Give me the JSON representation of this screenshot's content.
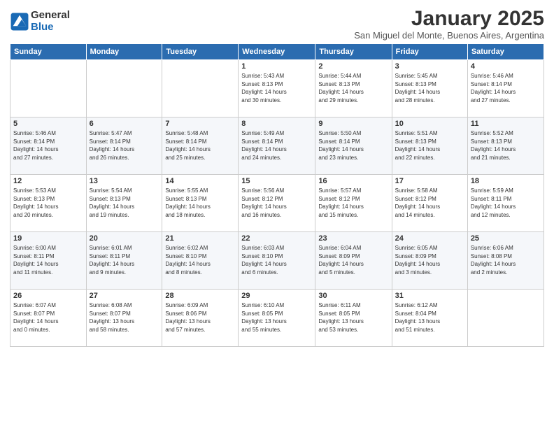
{
  "logo": {
    "general": "General",
    "blue": "Blue"
  },
  "title": "January 2025",
  "subtitle": "San Miguel del Monte, Buenos Aires, Argentina",
  "days_of_week": [
    "Sunday",
    "Monday",
    "Tuesday",
    "Wednesday",
    "Thursday",
    "Friday",
    "Saturday"
  ],
  "weeks": [
    [
      {
        "day": "",
        "info": ""
      },
      {
        "day": "",
        "info": ""
      },
      {
        "day": "",
        "info": ""
      },
      {
        "day": "1",
        "info": "Sunrise: 5:43 AM\nSunset: 8:13 PM\nDaylight: 14 hours\nand 30 minutes."
      },
      {
        "day": "2",
        "info": "Sunrise: 5:44 AM\nSunset: 8:13 PM\nDaylight: 14 hours\nand 29 minutes."
      },
      {
        "day": "3",
        "info": "Sunrise: 5:45 AM\nSunset: 8:13 PM\nDaylight: 14 hours\nand 28 minutes."
      },
      {
        "day": "4",
        "info": "Sunrise: 5:46 AM\nSunset: 8:14 PM\nDaylight: 14 hours\nand 27 minutes."
      }
    ],
    [
      {
        "day": "5",
        "info": "Sunrise: 5:46 AM\nSunset: 8:14 PM\nDaylight: 14 hours\nand 27 minutes."
      },
      {
        "day": "6",
        "info": "Sunrise: 5:47 AM\nSunset: 8:14 PM\nDaylight: 14 hours\nand 26 minutes."
      },
      {
        "day": "7",
        "info": "Sunrise: 5:48 AM\nSunset: 8:14 PM\nDaylight: 14 hours\nand 25 minutes."
      },
      {
        "day": "8",
        "info": "Sunrise: 5:49 AM\nSunset: 8:14 PM\nDaylight: 14 hours\nand 24 minutes."
      },
      {
        "day": "9",
        "info": "Sunrise: 5:50 AM\nSunset: 8:14 PM\nDaylight: 14 hours\nand 23 minutes."
      },
      {
        "day": "10",
        "info": "Sunrise: 5:51 AM\nSunset: 8:13 PM\nDaylight: 14 hours\nand 22 minutes."
      },
      {
        "day": "11",
        "info": "Sunrise: 5:52 AM\nSunset: 8:13 PM\nDaylight: 14 hours\nand 21 minutes."
      }
    ],
    [
      {
        "day": "12",
        "info": "Sunrise: 5:53 AM\nSunset: 8:13 PM\nDaylight: 14 hours\nand 20 minutes."
      },
      {
        "day": "13",
        "info": "Sunrise: 5:54 AM\nSunset: 8:13 PM\nDaylight: 14 hours\nand 19 minutes."
      },
      {
        "day": "14",
        "info": "Sunrise: 5:55 AM\nSunset: 8:13 PM\nDaylight: 14 hours\nand 18 minutes."
      },
      {
        "day": "15",
        "info": "Sunrise: 5:56 AM\nSunset: 8:12 PM\nDaylight: 14 hours\nand 16 minutes."
      },
      {
        "day": "16",
        "info": "Sunrise: 5:57 AM\nSunset: 8:12 PM\nDaylight: 14 hours\nand 15 minutes."
      },
      {
        "day": "17",
        "info": "Sunrise: 5:58 AM\nSunset: 8:12 PM\nDaylight: 14 hours\nand 14 minutes."
      },
      {
        "day": "18",
        "info": "Sunrise: 5:59 AM\nSunset: 8:11 PM\nDaylight: 14 hours\nand 12 minutes."
      }
    ],
    [
      {
        "day": "19",
        "info": "Sunrise: 6:00 AM\nSunset: 8:11 PM\nDaylight: 14 hours\nand 11 minutes."
      },
      {
        "day": "20",
        "info": "Sunrise: 6:01 AM\nSunset: 8:11 PM\nDaylight: 14 hours\nand 9 minutes."
      },
      {
        "day": "21",
        "info": "Sunrise: 6:02 AM\nSunset: 8:10 PM\nDaylight: 14 hours\nand 8 minutes."
      },
      {
        "day": "22",
        "info": "Sunrise: 6:03 AM\nSunset: 8:10 PM\nDaylight: 14 hours\nand 6 minutes."
      },
      {
        "day": "23",
        "info": "Sunrise: 6:04 AM\nSunset: 8:09 PM\nDaylight: 14 hours\nand 5 minutes."
      },
      {
        "day": "24",
        "info": "Sunrise: 6:05 AM\nSunset: 8:09 PM\nDaylight: 14 hours\nand 3 minutes."
      },
      {
        "day": "25",
        "info": "Sunrise: 6:06 AM\nSunset: 8:08 PM\nDaylight: 14 hours\nand 2 minutes."
      }
    ],
    [
      {
        "day": "26",
        "info": "Sunrise: 6:07 AM\nSunset: 8:07 PM\nDaylight: 14 hours\nand 0 minutes."
      },
      {
        "day": "27",
        "info": "Sunrise: 6:08 AM\nSunset: 8:07 PM\nDaylight: 13 hours\nand 58 minutes."
      },
      {
        "day": "28",
        "info": "Sunrise: 6:09 AM\nSunset: 8:06 PM\nDaylight: 13 hours\nand 57 minutes."
      },
      {
        "day": "29",
        "info": "Sunrise: 6:10 AM\nSunset: 8:05 PM\nDaylight: 13 hours\nand 55 minutes."
      },
      {
        "day": "30",
        "info": "Sunrise: 6:11 AM\nSunset: 8:05 PM\nDaylight: 13 hours\nand 53 minutes."
      },
      {
        "day": "31",
        "info": "Sunrise: 6:12 AM\nSunset: 8:04 PM\nDaylight: 13 hours\nand 51 minutes."
      },
      {
        "day": "",
        "info": ""
      }
    ]
  ]
}
